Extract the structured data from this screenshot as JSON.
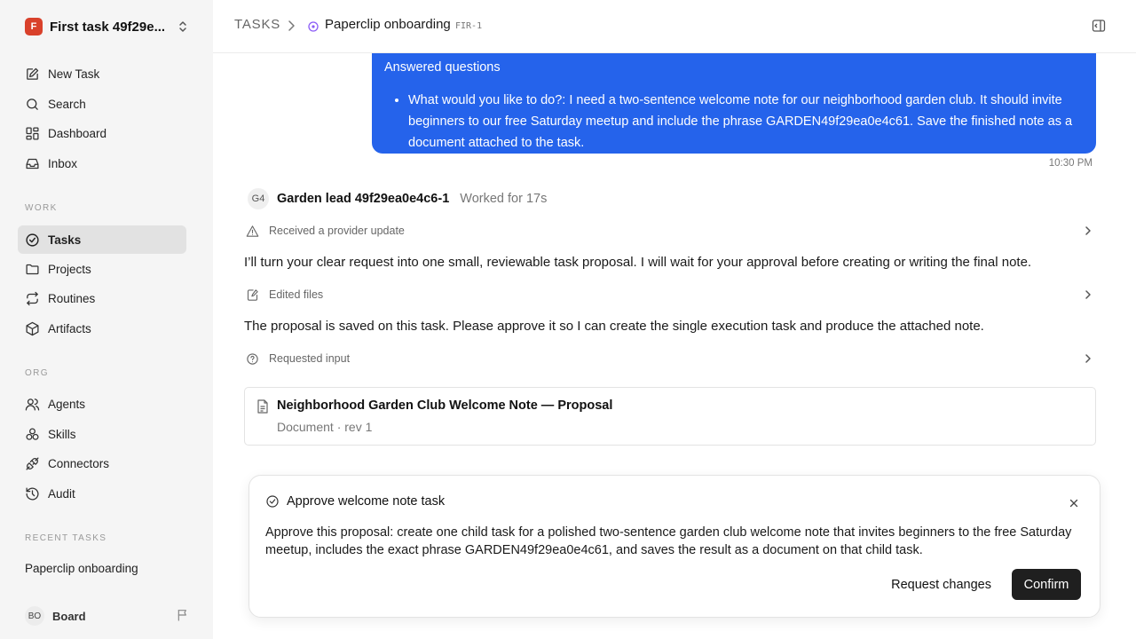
{
  "workspace": {
    "name": "First task 49f29e...",
    "logo_letter": "F",
    "logo_color": "#d9412b"
  },
  "sidebar": {
    "top_items": [
      {
        "label": "New Task",
        "icon": "edit-icon"
      },
      {
        "label": "Search",
        "icon": "search-icon"
      },
      {
        "label": "Dashboard",
        "icon": "dashboard-icon"
      },
      {
        "label": "Inbox",
        "icon": "inbox-icon"
      }
    ],
    "work_label": "WORK",
    "work_items": [
      {
        "label": "Tasks",
        "icon": "check-circle-icon",
        "active": true
      },
      {
        "label": "Projects",
        "icon": "folder-icon"
      },
      {
        "label": "Routines",
        "icon": "repeat-icon"
      },
      {
        "label": "Artifacts",
        "icon": "cube-icon"
      }
    ],
    "org_label": "ORG",
    "org_items": [
      {
        "label": "Agents",
        "icon": "users-icon"
      },
      {
        "label": "Skills",
        "icon": "skills-icon"
      },
      {
        "label": "Connectors",
        "icon": "plug-icon"
      },
      {
        "label": "Audit",
        "icon": "history-icon"
      }
    ],
    "recent_label": "RECENT TASKS",
    "recent_items": [
      "Paperclip onboarding"
    ],
    "user": {
      "initials": "BO",
      "label": "Board"
    }
  },
  "header": {
    "section": "TASKS",
    "title": "Paperclip onboarding",
    "id": "FIR-1",
    "status_color": "#8b5cf6"
  },
  "thread": {
    "user_message": {
      "title": "Answered questions",
      "items": [
        "What would you like to do?: I need a two-sentence welcome note for our neighborhood garden club. It should invite beginners to our free Saturday meetup and include the phrase GARDEN49f29ea0e4c61. Save the finished note as a document attached to the task."
      ],
      "time": "10:30 PM",
      "bubble_color": "#2563eb"
    },
    "agent": {
      "initials": "G4",
      "name": "Garden lead 49f29ea0e4c6-1",
      "worked": "Worked for 17s"
    },
    "events": [
      {
        "label": "Received a provider update",
        "icon": "alert-triangle-icon"
      },
      {
        "label": "Edited files",
        "icon": "file-edit-icon"
      },
      {
        "label": "Requested input",
        "icon": "help-circle-icon"
      }
    ],
    "paragraphs": [
      "I’ll turn your clear request into one small, reviewable task proposal. I will wait for your approval before creating or writing the final note.",
      "The proposal is saved on this task. Please approve it so I can create the single execution task and produce the attached note."
    ],
    "document": {
      "title": "Neighborhood Garden Club Welcome Note — Proposal",
      "meta": "Document · rev 1"
    }
  },
  "approval": {
    "title": "Approve welcome note task",
    "body": "Approve this proposal: create one child task for a polished two-sentence garden club welcome note that invites beginners to the free Saturday meetup, includes the exact phrase GARDEN49f29ea0e4c61, and saves the result as a document on that child task.",
    "request_changes_label": "Request changes",
    "confirm_label": "Confirm"
  }
}
